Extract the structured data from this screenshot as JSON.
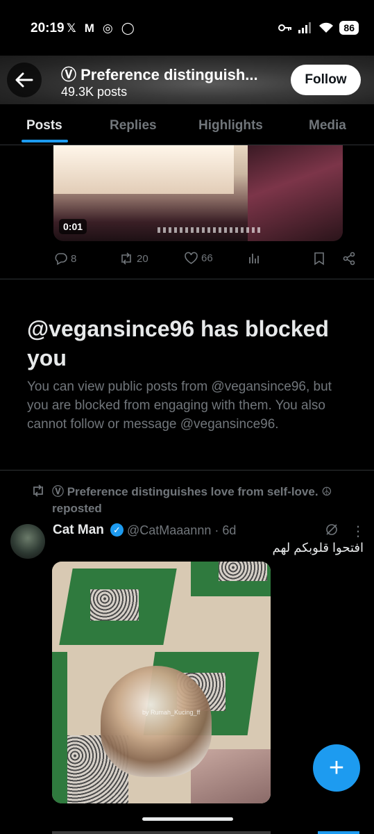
{
  "status_bar": {
    "time": "20:19",
    "left_icons": [
      "𝕏",
      "M",
      "◎",
      "◯"
    ],
    "battery": "86"
  },
  "header": {
    "title": "Ⓥ Preference distinguish...",
    "subtitle": "49.3K posts",
    "follow_label": "Follow"
  },
  "tabs": [
    {
      "label": "Posts",
      "active": true
    },
    {
      "label": "Replies"
    },
    {
      "label": "Highlights"
    },
    {
      "label": "Media"
    }
  ],
  "video_post": {
    "duration": "0:01",
    "replies": "8",
    "reposts": "20",
    "likes": "66"
  },
  "blocked": {
    "title": "@vegansince96 has blocked you",
    "body": "You can view public posts from @vegansince96, but you are blocked from engaging with them. You also cannot follow or message @vegansince96."
  },
  "repost": {
    "label": "Ⓥ Preference distinguishes love from self-love. ☮ reposted"
  },
  "tweet": {
    "name": "Cat Man",
    "handle": "@CatMaaannn · 6d",
    "text": "افتحوا قلوبكم لهم",
    "watermark": "by Rumah_Kucing_ff"
  },
  "colors": {
    "accent": "#1d9bf0",
    "muted": "#71767b",
    "text": "#e7e9ea",
    "divider": "#2f3336"
  }
}
